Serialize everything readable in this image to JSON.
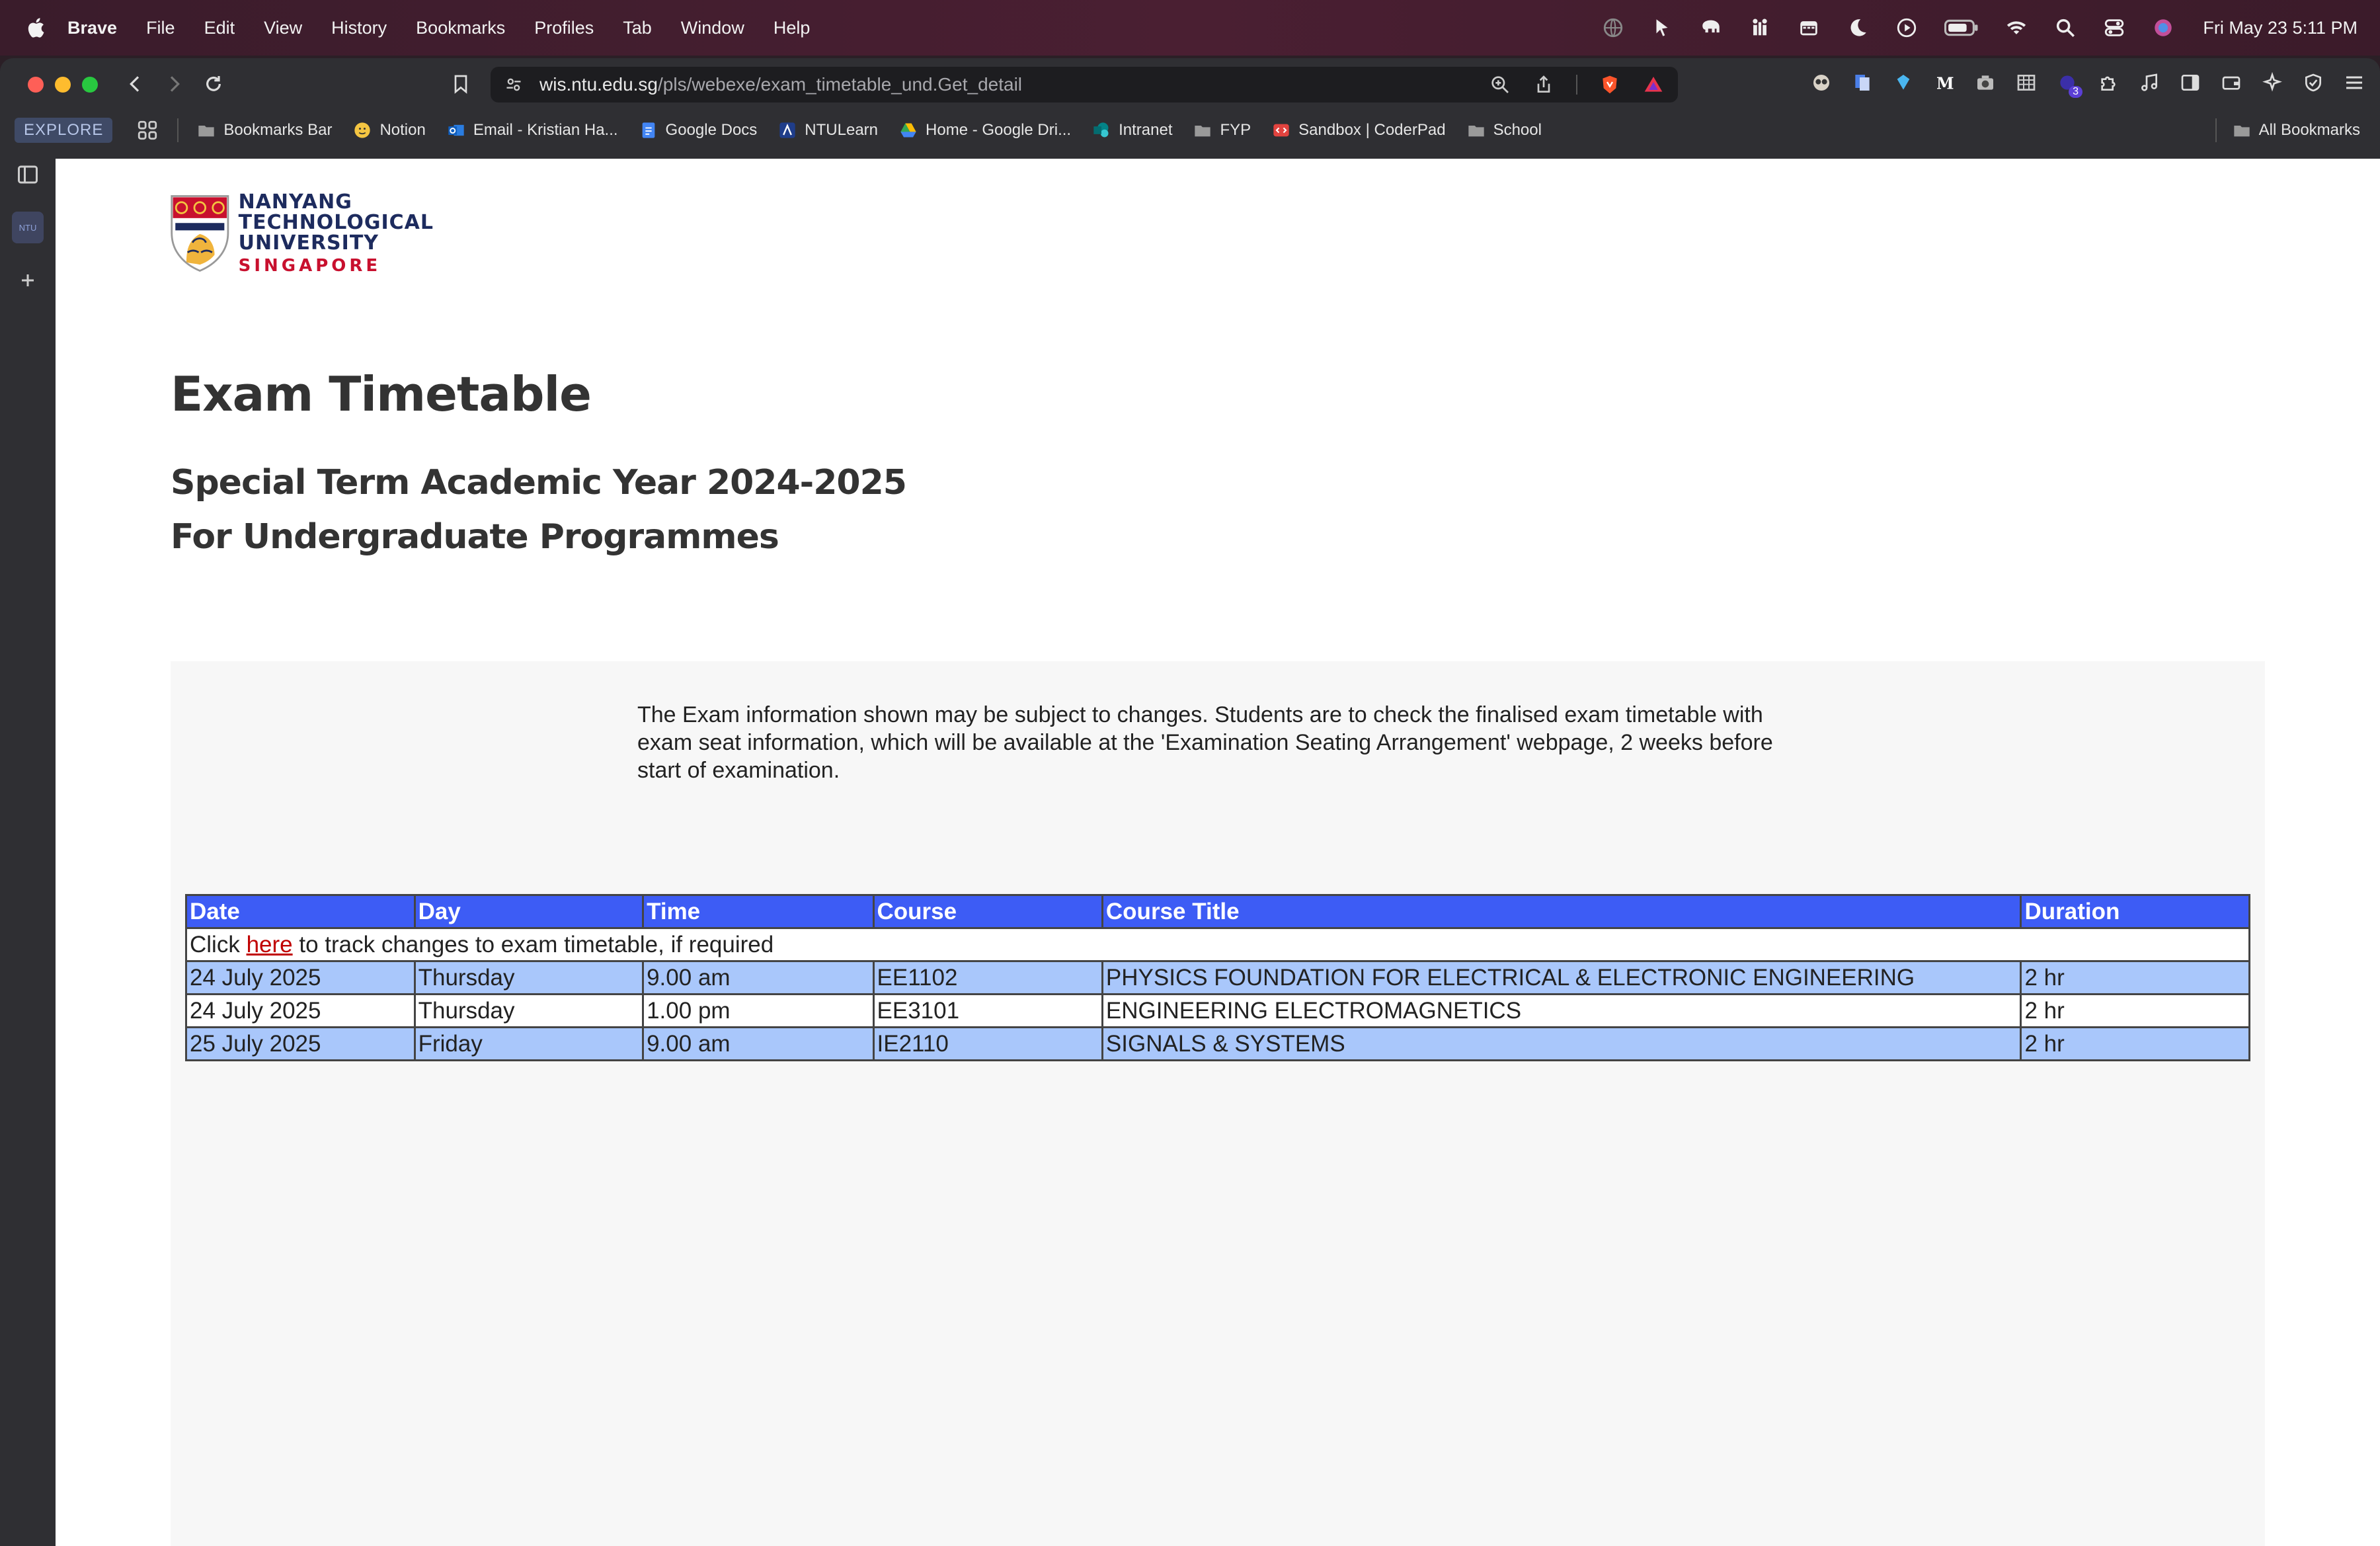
{
  "menubar": {
    "app_name": "Brave",
    "items": [
      "File",
      "Edit",
      "View",
      "History",
      "Bookmarks",
      "Profiles",
      "Tab",
      "Window",
      "Help"
    ],
    "clock": "Fri May 23  5:11 PM"
  },
  "browser": {
    "url_host": "wis.ntu.edu.sg",
    "url_path": "/pls/webexe/exam_timetable_und.Get_detail",
    "extension_badge": "3"
  },
  "bookmarks": {
    "explore_label": "EXPLORE",
    "items": [
      {
        "label": "Bookmarks Bar",
        "icon": "folder-icon"
      },
      {
        "label": "Notion",
        "icon": "notion-icon"
      },
      {
        "label": "Email - Kristian Ha...",
        "icon": "outlook-icon"
      },
      {
        "label": "Google Docs",
        "icon": "google-docs-icon"
      },
      {
        "label": "NTULearn",
        "icon": "ntulearn-icon"
      },
      {
        "label": "Home - Google Dri...",
        "icon": "google-drive-icon"
      },
      {
        "label": "Intranet",
        "icon": "sharepoint-icon"
      },
      {
        "label": "FYP",
        "icon": "folder-icon"
      },
      {
        "label": "Sandbox | CoderPad",
        "icon": "coderpad-icon"
      },
      {
        "label": "School",
        "icon": "folder-icon"
      }
    ],
    "all_bookmarks_label": "All Bookmarks"
  },
  "sidepanel": {
    "tab_label": "NTU"
  },
  "logo": {
    "line1": "NANYANG",
    "line2": "TECHNOLOGICAL",
    "line3": "UNIVERSITY",
    "line4": "SINGAPORE"
  },
  "page": {
    "title": "Exam Timetable",
    "subtitle1": "Special Term Academic Year 2024-2025",
    "subtitle2": "For Undergraduate Programmes",
    "notice": "The Exam information shown may be subject to changes. Students are to check the finalised exam timetable with exam seat information, which will be available at the 'Examination Seating Arrangement' webpage, 2 weeks before start of examination.",
    "track_prefix": "Click ",
    "track_link": "here",
    "track_suffix": " to track changes to exam timetable, if required"
  },
  "table": {
    "headers": [
      "Date",
      "Day",
      "Time",
      "Course",
      "Course Title",
      "Duration"
    ],
    "rows": [
      [
        "24 July 2025",
        "Thursday",
        "9.00 am",
        "EE1102",
        "PHYSICS FOUNDATION FOR ELECTRICAL & ELECTRONIC ENGINEERING",
        "2 hr"
      ],
      [
        "24 July 2025",
        "Thursday",
        "1.00 pm",
        "EE3101",
        "ENGINEERING ELECTROMAGNETICS",
        "2 hr"
      ],
      [
        "25 July 2025",
        "Friday",
        "9.00 am",
        "IE2110",
        "SIGNALS & SYSTEMS",
        "2 hr"
      ]
    ]
  },
  "colors": {
    "header_blue": "#3d5cf5",
    "row_blue": "#a9c7fb",
    "link_red": "#c00000",
    "ntu_navy": "#1d2b5e",
    "ntu_red": "#c8102e"
  }
}
